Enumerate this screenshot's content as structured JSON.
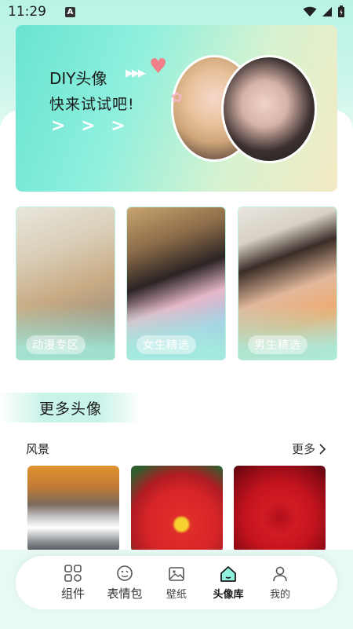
{
  "status_bar": {
    "time": "11:29"
  },
  "banner": {
    "title": "DIY头像",
    "title_arrows": "▶▶▶",
    "subtitle": "快来试试吧!",
    "chevrons": "> > >"
  },
  "categories": [
    {
      "label": "动漫专区"
    },
    {
      "label": "女生精选"
    },
    {
      "label": "男生精选"
    }
  ],
  "more_section": {
    "title": "更多头像"
  },
  "scenery_row": {
    "title": "风景",
    "more_label": "更多"
  },
  "bottom_nav": [
    {
      "label": "组件",
      "icon": "widgets-icon",
      "active": false
    },
    {
      "label": "表情包",
      "icon": "emoji-icon",
      "active": false
    },
    {
      "label": "壁纸",
      "icon": "wallpaper-icon",
      "active": false
    },
    {
      "label": "头像库",
      "icon": "home-icon",
      "active": true
    },
    {
      "label": "我的",
      "icon": "profile-icon",
      "active": false
    }
  ],
  "colors": {
    "accent": "#1fb98c",
    "banner_start": "#69e3d2",
    "banner_end": "#f3eac4"
  }
}
